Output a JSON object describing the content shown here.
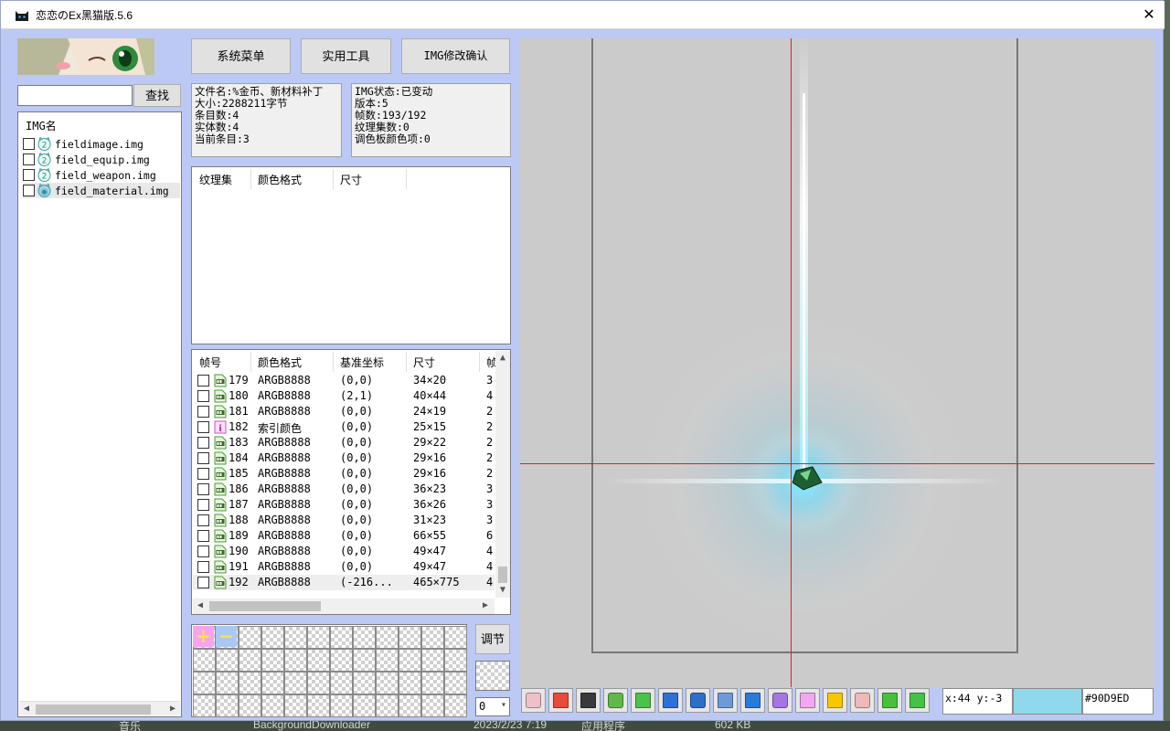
{
  "window": {
    "title": "恋恋のEx黑猫版.5.6",
    "close_glyph": "✕"
  },
  "search": {
    "value": "",
    "button_label": "查找"
  },
  "img_list": {
    "header": "IMG名",
    "items": [
      {
        "name": "fieldimage.img",
        "icon": "cat-face-icon",
        "selected": false
      },
      {
        "name": "field_equip.img",
        "icon": "cat-face-icon",
        "selected": false
      },
      {
        "name": "field_weapon.img",
        "icon": "cat-face-icon",
        "selected": false
      },
      {
        "name": "field_material.img",
        "icon": "cat-face-blue-icon",
        "selected": true
      }
    ]
  },
  "top_buttons": {
    "system_menu": "系统菜单",
    "tools": "实用工具",
    "img_confirm": "IMG修改确认"
  },
  "file_info": {
    "name": "文件名:%金币、新材料补丁",
    "size": "大小:2288211字节",
    "entries": "条目数:4",
    "entities": "实体数:4",
    "current": "当前条目:3"
  },
  "img_info": {
    "status": "IMG状态:已变动",
    "version": "版本:5",
    "frames": "帧数:193/192",
    "texture_sets": "纹理集数:0",
    "palette_items": "调色板颜色项:0"
  },
  "texture_table": {
    "columns": [
      "纹理集",
      "颜色格式",
      "尺寸"
    ]
  },
  "frame_table": {
    "columns": [
      "帧号",
      "颜色格式",
      "基准坐标",
      "尺寸",
      "帧"
    ],
    "rows": [
      {
        "id": "179",
        "format": "ARGB8888",
        "base": "(0,0)",
        "size": "34×20",
        "extra": "3",
        "icon": "argb-frame-icon"
      },
      {
        "id": "180",
        "format": "ARGB8888",
        "base": "(2,1)",
        "size": "40×44",
        "extra": "4",
        "icon": "argb-frame-icon"
      },
      {
        "id": "181",
        "format": "ARGB8888",
        "base": "(0,0)",
        "size": "24×19",
        "extra": "2",
        "icon": "argb-frame-icon"
      },
      {
        "id": "182",
        "format": "索引颜色",
        "base": "(0,0)",
        "size": "25×15",
        "extra": "2",
        "icon": "index-frame-icon"
      },
      {
        "id": "183",
        "format": "ARGB8888",
        "base": "(0,0)",
        "size": "29×22",
        "extra": "2",
        "icon": "argb-frame-icon"
      },
      {
        "id": "184",
        "format": "ARGB8888",
        "base": "(0,0)",
        "size": "29×16",
        "extra": "2",
        "icon": "argb-frame-icon"
      },
      {
        "id": "185",
        "format": "ARGB8888",
        "base": "(0,0)",
        "size": "29×16",
        "extra": "2",
        "icon": "argb-frame-icon"
      },
      {
        "id": "186",
        "format": "ARGB8888",
        "base": "(0,0)",
        "size": "36×23",
        "extra": "3",
        "icon": "argb-frame-icon"
      },
      {
        "id": "187",
        "format": "ARGB8888",
        "base": "(0,0)",
        "size": "36×26",
        "extra": "3",
        "icon": "argb-frame-icon"
      },
      {
        "id": "188",
        "format": "ARGB8888",
        "base": "(0,0)",
        "size": "31×23",
        "extra": "3",
        "icon": "argb-frame-icon"
      },
      {
        "id": "189",
        "format": "ARGB8888",
        "base": "(0,0)",
        "size": "66×55",
        "extra": "6",
        "icon": "argb-frame-icon"
      },
      {
        "id": "190",
        "format": "ARGB8888",
        "base": "(0,0)",
        "size": "49×47",
        "extra": "4",
        "icon": "argb-frame-icon"
      },
      {
        "id": "191",
        "format": "ARGB8888",
        "base": "(0,0)",
        "size": "49×47",
        "extra": "4",
        "icon": "argb-frame-icon"
      },
      {
        "id": "192",
        "format": "ARGB8888",
        "base": "(-216...",
        "size": "465×775",
        "extra": "4",
        "icon": "argb-frame-icon",
        "selected": true
      }
    ]
  },
  "palette": {
    "add_label": "+",
    "remove_label": "−",
    "adjust_label": "调节",
    "zoom_value": "0"
  },
  "toolbar": {
    "tools": [
      {
        "name": "calendar-tool-icon",
        "color": "#f0c0c8"
      },
      {
        "name": "palette-tool-icon",
        "color": "#e84a3c"
      },
      {
        "name": "film-tool-icon",
        "color": "#3a3a3a"
      },
      {
        "name": "cat-tool-icon",
        "color": "#5fb848"
      },
      {
        "name": "projector-tool-icon",
        "color": "#4bc24b"
      },
      {
        "name": "paw-tool-icon",
        "color": "#2f6fd8"
      },
      {
        "name": "magnifier-tool-icon",
        "color": "#2d6ec8"
      },
      {
        "name": "anchor-tool-icon",
        "color": "#6f9ad8"
      },
      {
        "name": "crop-tool-icon",
        "color": "#2a7ad8"
      },
      {
        "name": "pencil-tool-icon",
        "color": "#a476e0"
      },
      {
        "name": "line-tool-icon",
        "color": "#f2a8f0"
      },
      {
        "name": "rectangle-tool-icon",
        "color": "#f7c800"
      },
      {
        "name": "eraser-tool-icon",
        "color": "#f0b8b8"
      },
      {
        "name": "eyedropper-tool-icon",
        "color": "#48c03a"
      },
      {
        "name": "tag-tool-icon",
        "color": "#45c245"
      }
    ],
    "coords": "x:44 y:-3",
    "color_hex": "#90D9ED",
    "current_color": "#90D9ED"
  },
  "taskbar_peek": {
    "item1": "音乐",
    "item2": "BackgroundDownloader",
    "item3": "2023/2/23 7:19",
    "item4": "应用程序",
    "item5": "602 KB"
  }
}
